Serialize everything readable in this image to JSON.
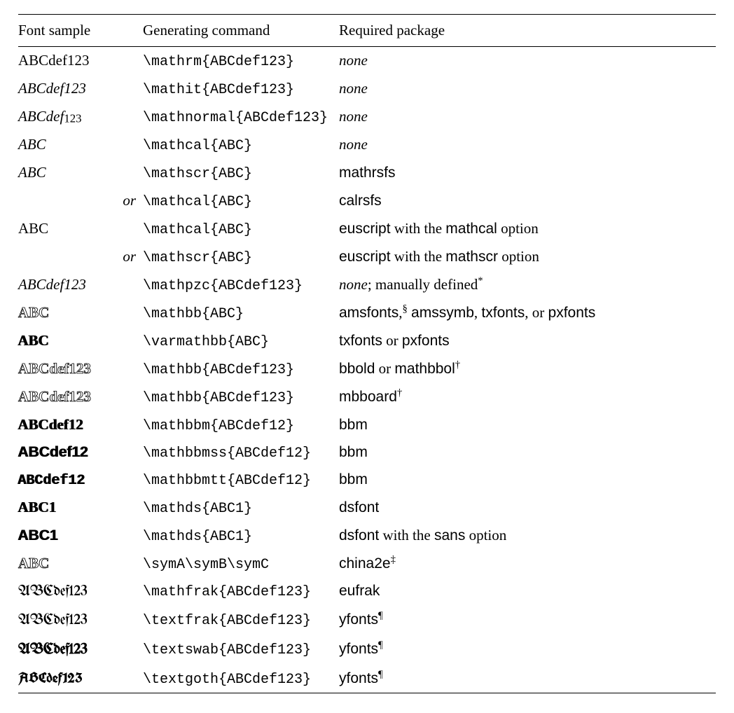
{
  "chart_data": {
    "type": "table",
    "columns": [
      "Font sample",
      "Generating command",
      "Required package"
    ],
    "rows": [
      [
        "ABCdef123",
        "\\mathrm{ABCdef123}",
        "none"
      ],
      [
        "ABCdef123",
        "\\mathit{ABCdef123}",
        "none"
      ],
      [
        "ABCdef123",
        "\\mathnormal{ABCdef123}",
        "none"
      ],
      [
        "ABC",
        "\\mathcal{ABC}",
        "none"
      ],
      [
        "ABC",
        "\\mathscr{ABC}",
        "mathrsfs"
      ],
      [
        "or",
        "\\mathcal{ABC}",
        "calrsfs"
      ],
      [
        "ABC",
        "\\mathcal{ABC}",
        "euscript with the mathcal option"
      ],
      [
        "or",
        "\\mathscr{ABC}",
        "euscript with the mathscr option"
      ],
      [
        "ABCdef123",
        "\\mathpzc{ABCdef123}",
        "none; manually defined*"
      ],
      [
        "ABC",
        "\\mathbb{ABC}",
        "amsfonts,§ amssymb, txfonts, or pxfonts"
      ],
      [
        "ABC",
        "\\varmathbb{ABC}",
        "txfonts or pxfonts"
      ],
      [
        "ABCdef123",
        "\\mathbb{ABCdef123}",
        "bbold or mathbbol†"
      ],
      [
        "ABCdef123",
        "\\mathbb{ABCdef123}",
        "mbboard†"
      ],
      [
        "ABCdef12",
        "\\mathbbm{ABCdef12}",
        "bbm"
      ],
      [
        "ABCdef12",
        "\\mathbbmss{ABCdef12}",
        "bbm"
      ],
      [
        "ABCdef12",
        "\\mathbbmtt{ABCdef12}",
        "bbm"
      ],
      [
        "ABC1",
        "\\mathds{ABC1}",
        "dsfont"
      ],
      [
        "ABC1",
        "\\mathds{ABC1}",
        "dsfont with the sans option"
      ],
      [
        "ABC",
        "\\symA\\symB\\symC",
        "china2e‡"
      ],
      [
        "ABCdef123",
        "\\mathfrak{ABCdef123}",
        "eufrak"
      ],
      [
        "ABCdef123",
        "\\textfrak{ABCdef123}",
        "yfonts¶"
      ],
      [
        "ABCdef123",
        "\\textswab{ABCdef123}",
        "yfonts¶"
      ],
      [
        "ABCdef123",
        "\\textgoth{ABCdef123}",
        "yfonts¶"
      ]
    ]
  },
  "head": {
    "sample": "Font sample",
    "command": "Generating command",
    "package": "Required package"
  },
  "word": {
    "or": "or",
    "none": "none",
    "with_the": "with the",
    "option": "option",
    "manual": "; manually defined",
    "or_sep": "or",
    "comma": ","
  },
  "pkg": {
    "mathrsfs": "mathrsfs",
    "calrsfs": "calrsfs",
    "euscript": "euscript",
    "mathcal": "mathcal",
    "mathscr": "mathscr",
    "amsfonts": "amsfonts",
    "amssymb": "amssymb",
    "txfonts": "txfonts",
    "pxfonts": "pxfonts",
    "bbold": "bbold",
    "mathbbol": "mathbbol",
    "mbboard": "mbboard",
    "bbm": "bbm",
    "dsfont": "dsfont",
    "sans": "sans",
    "china2e": "china2e",
    "eufrak": "eufrak",
    "yfonts": "yfonts"
  },
  "fn": {
    "ast": "*",
    "sec": "§",
    "dag": "†",
    "ddag": "‡",
    "para": "¶"
  },
  "s": {
    "rm": "ABCdef123",
    "it": "ABCdef123",
    "norm1": "ABCdef",
    "norm2": "123",
    "cal": "ABC",
    "scr": "ABC",
    "eus": "ABC",
    "pzc": "ABCdef123",
    "bb": "ABC",
    "vbb": "ABC",
    "bbold": "ABCdef123",
    "mbb": "ABCdef123",
    "bbm": "ABCdef12",
    "bbmss": "ABCdef12",
    "bbmtt": "ABCdef12",
    "ds": "ABC1",
    "dss": "ABC1",
    "ch": "ABC",
    "frak": "ABCdef123",
    "tf": "ABCdef123",
    "sw": "ABCdef123",
    "go": "ABCdef123"
  },
  "c": {
    "rm": "\\mathrm{ABCdef123}",
    "it": "\\mathit{ABCdef123}",
    "norm": "\\mathnormal{ABCdef123}",
    "cal": "\\mathcal{ABC}",
    "scr": "\\mathscr{ABC}",
    "pzc": "\\mathpzc{ABCdef123}",
    "bb": "\\mathbb{ABC}",
    "vbb": "\\varmathbb{ABC}",
    "bbf": "\\mathbb{ABCdef123}",
    "bbm": "\\mathbbm{ABCdef12}",
    "bbmss": "\\mathbbmss{ABCdef12}",
    "bbmtt": "\\mathbbmtt{ABCdef12}",
    "ds": "\\mathds{ABC1}",
    "sym": "\\symA\\symB\\symC",
    "frak": "\\mathfrak{ABCdef123}",
    "tf": "\\textfrak{ABCdef123}",
    "sw": "\\textswab{ABCdef123}",
    "go": "\\textgoth{ABCdef123}"
  }
}
